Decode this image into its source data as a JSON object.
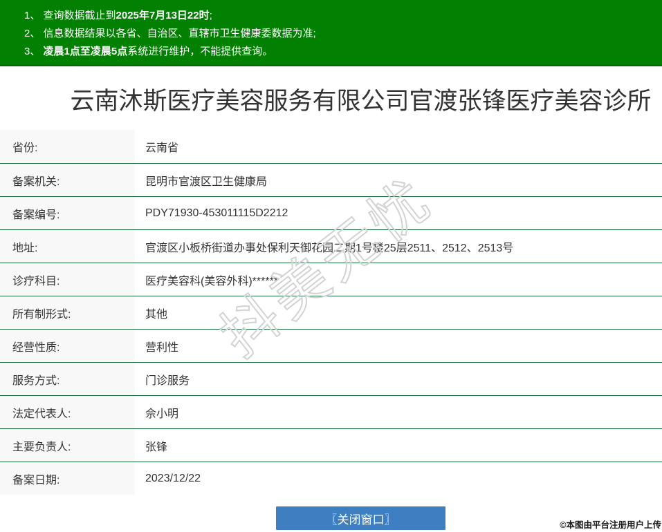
{
  "notices": [
    {
      "prefix": "1、 查询数据截止到",
      "bold": "2025年7月13日22时",
      "suffix": ";"
    },
    {
      "prefix": "2、 信息数据结果以各省、自治区、直辖市卫生健康委数据为准;",
      "bold": "",
      "suffix": ""
    },
    {
      "prefix": "3、 ",
      "bold": "凌晨1点至凌晨5点",
      "suffix": "系统进行维护，不能提供查询。"
    }
  ],
  "title": "云南沐斯医疗美容服务有限公司官渡张锋医疗美容诊所",
  "table": {
    "rows": [
      {
        "label": "省份:",
        "value": "云南省"
      },
      {
        "label": "备案机关:",
        "value": "昆明市官渡区卫生健康局"
      },
      {
        "label": "备案编号:",
        "value": "PDY71930-453011115D2212"
      },
      {
        "label": "地址:",
        "value": "官渡区小板桥街道办事处保利天御花园二期1号楼25层2511、2512、2513号"
      },
      {
        "label": "诊疗科目:",
        "value": "医疗美容科(美容外科)******"
      },
      {
        "label": "所有制形式:",
        "value": "其他"
      },
      {
        "label": "经营性质:",
        "value": "营利性"
      },
      {
        "label": "服务方式:",
        "value": "门诊服务"
      },
      {
        "label": "法定代表人:",
        "value": "佘小明"
      },
      {
        "label": "主要负责人:",
        "value": "张锋"
      },
      {
        "label": "备案日期:",
        "value": "2023/12/22"
      }
    ]
  },
  "close_button_label": "〖关闭窗口〗",
  "watermark": "抖美无忧",
  "credit": "©本图由平台注册用户上传",
  "colors": {
    "header_green": "#018001",
    "divider_green": "#1a6a41",
    "button_blue": "#3d7fc1",
    "label_bg": "#f8f8f8"
  }
}
